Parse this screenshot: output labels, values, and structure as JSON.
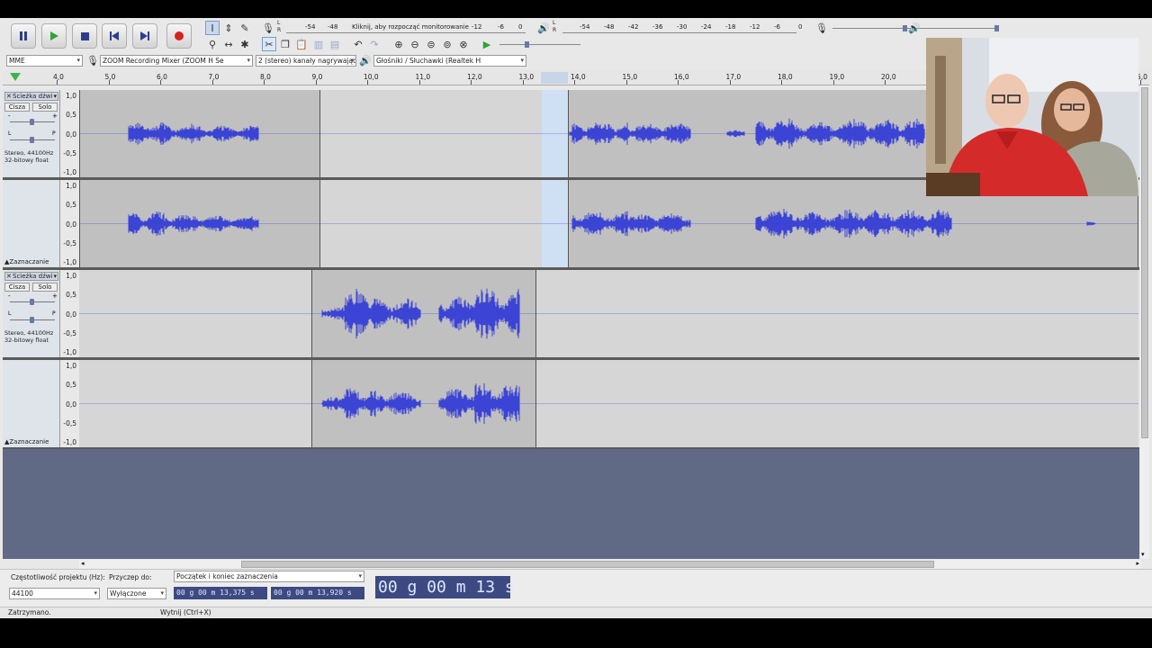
{
  "toolbar": {
    "meter_rec_scale": [
      "-54",
      "-48",
      "-12",
      "-6",
      "0"
    ],
    "meter_rec_prompt": "Kliknij, aby rozpocząć monitorowanie",
    "meter_play_scale": [
      "-54",
      "-48",
      "-42",
      "-36",
      "-30",
      "-24",
      "-18",
      "-12",
      "-6",
      "0"
    ],
    "meter_lr": [
      "L",
      "R"
    ]
  },
  "device_toolbar": {
    "host": "MME",
    "input_device": "ZOOM Recording Mixer (ZOOM H Se",
    "channels": "2 (stereo) kanały nagrywające",
    "output_device": "Głośniki / Słuchawki (Realtek H"
  },
  "ruler": {
    "labels": [
      "4,0",
      "5,0",
      "6,0",
      "7,0",
      "8,0",
      "9,0",
      "10,0",
      "11,0",
      "12,0",
      "13,0",
      "14,0",
      "15,0",
      "16,0",
      "17,0",
      "18,0",
      "19,0",
      "20,0",
      "5,0"
    ]
  },
  "tracks": [
    {
      "name": "Ścieżka dźwi",
      "mute": "Cisza",
      "solo": "Solo",
      "info_line1": "Stereo, 44100Hz",
      "info_line2": "32-bitowy float",
      "select": "Zaznaczanie",
      "gain_l": "L",
      "gain_r": "P",
      "vol_minus": "-",
      "vol_plus": "+"
    },
    {
      "name": "Ścieżka dźwi",
      "mute": "Cisza",
      "solo": "Solo",
      "info_line1": "Stereo, 44100Hz",
      "info_line2": "32-bitowy float",
      "select": "Zaznaczanie",
      "gain_l": "L",
      "gain_r": "P",
      "vol_minus": "-",
      "vol_plus": "+"
    }
  ],
  "vertical_ruler": [
    "1,0",
    "0,5",
    "0,0",
    "-0,5",
    "-1,0"
  ],
  "selection_bar": {
    "rate_label": "Częstotliwość projektu (Hz):",
    "rate_value": "44100",
    "snap_label": "Przyczep do:",
    "snap_value": "Wyłączone",
    "mode": "Początek i koniec zaznaczenia",
    "start_time": "00 g 00 m 13,375 s",
    "end_time": "00 g 00 m 13,920 s",
    "big_time": "00 g 00 m 13 s"
  },
  "status": {
    "left": "Zatrzymano.",
    "right": "Wytnij (Ctrl+X)"
  },
  "colors": {
    "wave": "#3b44d4",
    "selection": "#cfe0f5",
    "background": "#616a85"
  },
  "webcam": {
    "description_icon": "webcam-overlay"
  }
}
